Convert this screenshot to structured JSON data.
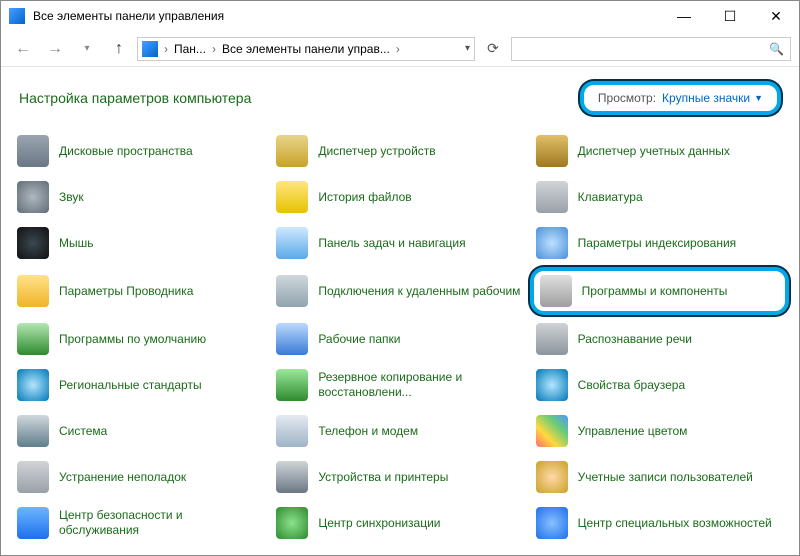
{
  "window": {
    "title": "Все элементы панели управления",
    "controls": {
      "min": "—",
      "max": "☐",
      "close": "✕"
    }
  },
  "nav": {
    "breadcrumbs": [
      "Пан...",
      "Все элементы панели управ..."
    ]
  },
  "header": {
    "title": "Настройка параметров компьютера",
    "view_label": "Просмотр:",
    "view_value": "Крупные значки"
  },
  "items": [
    {
      "id": "storage-spaces",
      "label": "Дисковые пространства",
      "icon": "ic-disk"
    },
    {
      "id": "device-manager",
      "label": "Диспетчер устройств",
      "icon": "ic-dev"
    },
    {
      "id": "credential-manager",
      "label": "Диспетчер учетных данных",
      "icon": "ic-cred"
    },
    {
      "id": "sound",
      "label": "Звук",
      "icon": "ic-sound"
    },
    {
      "id": "file-history",
      "label": "История файлов",
      "icon": "ic-hist"
    },
    {
      "id": "keyboard",
      "label": "Клавиатура",
      "icon": "ic-keyb"
    },
    {
      "id": "mouse",
      "label": "Мышь",
      "icon": "ic-mouse"
    },
    {
      "id": "taskbar-navigation",
      "label": "Панель задач и навигация",
      "icon": "ic-task"
    },
    {
      "id": "indexing-options",
      "label": "Параметры индексирования",
      "icon": "ic-index"
    },
    {
      "id": "explorer-options",
      "label": "Параметры Проводника",
      "icon": "ic-expl"
    },
    {
      "id": "remote-desktop",
      "label": "Подключения к удаленным рабочим",
      "icon": "ic-remote"
    },
    {
      "id": "programs-features",
      "label": "Программы и компоненты",
      "icon": "ic-prog",
      "highlight": true
    },
    {
      "id": "default-programs",
      "label": "Программы по умолчанию",
      "icon": "ic-def"
    },
    {
      "id": "work-folders",
      "label": "Рабочие папки",
      "icon": "ic-work"
    },
    {
      "id": "speech-recognition",
      "label": "Распознавание речи",
      "icon": "ic-speech"
    },
    {
      "id": "region",
      "label": "Региональные стандарты",
      "icon": "ic-region"
    },
    {
      "id": "backup-restore",
      "label": "Резервное копирование и восстановлени...",
      "icon": "ic-backup"
    },
    {
      "id": "internet-options",
      "label": "Свойства браузера",
      "icon": "ic-inet"
    },
    {
      "id": "system",
      "label": "Система",
      "icon": "ic-sys"
    },
    {
      "id": "phone-modem",
      "label": "Телефон и модем",
      "icon": "ic-phone"
    },
    {
      "id": "color-management",
      "label": "Управление цветом",
      "icon": "ic-color"
    },
    {
      "id": "troubleshooting",
      "label": "Устранение неполадок",
      "icon": "ic-trouble"
    },
    {
      "id": "devices-printers",
      "label": "Устройства и принтеры",
      "icon": "ic-print"
    },
    {
      "id": "user-accounts",
      "label": "Учетные записи пользователей",
      "icon": "ic-user"
    },
    {
      "id": "security-maintenance",
      "label": "Центр безопасности и обслуживания",
      "icon": "ic-sec"
    },
    {
      "id": "sync-center",
      "label": "Центр синхронизации",
      "icon": "ic-sync"
    },
    {
      "id": "ease-of-access",
      "label": "Центр специальных возможностей",
      "icon": "ic-ease"
    }
  ]
}
